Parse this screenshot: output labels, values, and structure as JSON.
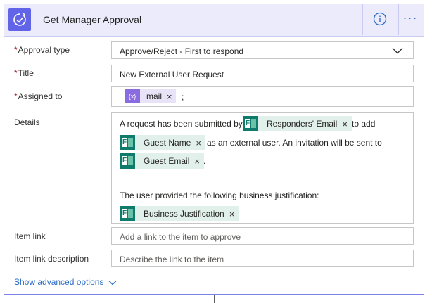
{
  "header": {
    "title": "Get Manager Approval",
    "icon": "approval-icon",
    "info_icon": "info-icon",
    "more_label": "···",
    "accent": "#6264e7"
  },
  "fields": {
    "approval_type": {
      "required_mark": "*",
      "label": "Approval type",
      "value": "Approve/Reject - First to respond"
    },
    "title": {
      "required_mark": "*",
      "label": "Title",
      "value": "New External User Request"
    },
    "assigned_to": {
      "required_mark": "*",
      "label": "Assigned to",
      "token": "mail",
      "token_icon_text": "{x}",
      "suffix": ";"
    },
    "details": {
      "label": "Details",
      "text1": "A request has been submitted by",
      "token1": "Responders' Email",
      "text2": "to add",
      "token2": "Guest Name",
      "text3": "as an external user.  An invitation will be sent to",
      "token3": "Guest Email",
      "text4": ".",
      "text5": "The user provided the following business justification:",
      "token4": "Business Justification"
    },
    "item_link": {
      "label": "Item link",
      "placeholder": "Add a link to the item to approve"
    },
    "item_link_description": {
      "label": "Item link description",
      "placeholder": "Describe the link to the item"
    }
  },
  "footer": {
    "advanced_label": "Show advanced options"
  },
  "token_remove": "×",
  "forms_icon_letter": "F",
  "colors": {
    "link": "#2b6cc4",
    "forms_green": "#0f7b6c",
    "required": "#a4262c"
  }
}
